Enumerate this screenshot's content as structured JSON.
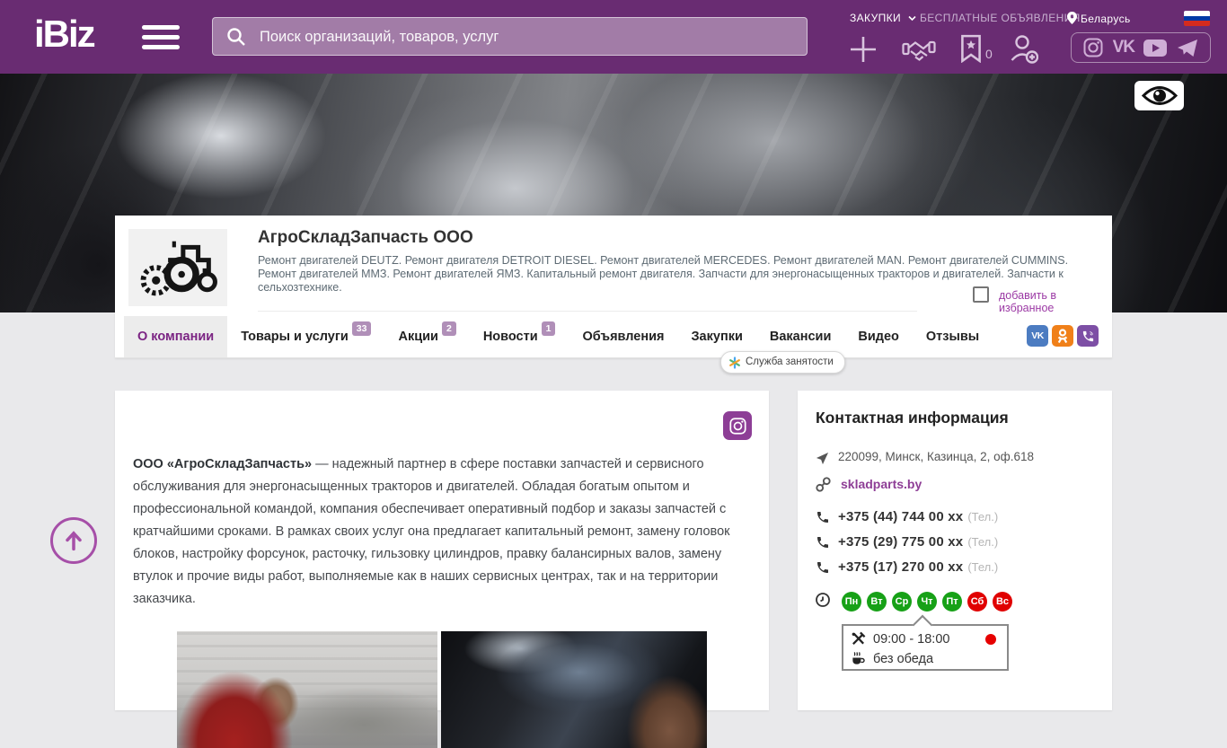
{
  "header": {
    "logo": "iBiz",
    "search_placeholder": "Поиск организаций, товаров, услуг",
    "links": {
      "purchases": "ЗАКУПКИ",
      "free_ads": "БЕСПЛАТНЫЕ ОБЪЯВЛЕНИЯ",
      "country": "Беларусь"
    },
    "favorites_count": "0",
    "icons": {
      "search": "magnifier",
      "menu": "hamburger",
      "location": "map-pin",
      "add": "plus",
      "partners": "handshake",
      "favorites": "bookmark-star",
      "profile": "user-add",
      "flag": "russia-tricolor",
      "vk_label": "VK",
      "socials": [
        "instagram",
        "vk",
        "youtube",
        "telegram"
      ]
    }
  },
  "company": {
    "name": "АгроСкладЗапчасть ООО",
    "summary": "Ремонт двигателей DEUTZ. Ремонт двигателя DETROIT DIESEL. Ремонт двигателей MERCEDES. Ремонт двигателей MAN. Ремонт двигателей CUMMINS. Ремонт двигателей ММЗ. Ремонт двигателей ЯМЗ. Капитальный ремонт двигателя. Запчасти для энергонасыщенных тракторов и двигателей. Запчасти к сельхозтехнике.",
    "add_favorite": "добавить в избранное",
    "logo_icon": "tractor-gear"
  },
  "tabs": [
    {
      "label": "О компании",
      "active": true
    },
    {
      "label": "Товары и услуги",
      "badge": "33"
    },
    {
      "label": "Акции",
      "badge": "2"
    },
    {
      "label": "Новости",
      "badge": "1"
    },
    {
      "label": "Объявления"
    },
    {
      "label": "Закупки"
    },
    {
      "label": "Вакансии"
    },
    {
      "label": "Видео"
    },
    {
      "label": "Отзывы"
    }
  ],
  "tab_socials": {
    "vk": "VK",
    "ok": "odnoklassniki",
    "viber": "viber"
  },
  "tooltip": {
    "label": "Служба занятости"
  },
  "about": {
    "lead_bold": "ООО «АгроСкладЗапчасть»",
    "text": " — надежный партнер в сфере поставки запчастей и сервисного обслуживания для энергонасыщенных тракторов и двигателей. Обладая богатым опытом и профессиональной командой, компания обеспечивает оперативный подбор и заказы запчастей с кратчайшими сроками. В рамках своих услуг она предлагает капитальный ремонт, замену головок блоков, настройку форсунок, расточку, гильзовку цилиндров, правку балансирных валов, замену втулок и прочие виды работ, выполняемые как в наших сервисных центрах, так и на территории заказчика."
  },
  "contact": {
    "title": "Контактная информация",
    "address": "220099, Минск, Казинца, 2, оф.618",
    "website": "skladparts.by",
    "phones": [
      {
        "number": "+375 (44) 744 00 xx",
        "type": "(Тел.)"
      },
      {
        "number": "+375 (29) 775 00 xx",
        "type": "(Тел.)"
      },
      {
        "number": "+375 (17) 270 00 xx",
        "type": "(Тел.)"
      }
    ],
    "days": [
      {
        "label": "Пн",
        "status": "open"
      },
      {
        "label": "Вт",
        "status": "open"
      },
      {
        "label": "Ср",
        "status": "open"
      },
      {
        "label": "Чт",
        "status": "open"
      },
      {
        "label": "Пт",
        "status": "open"
      },
      {
        "label": "Сб",
        "status": "closed"
      },
      {
        "label": "Вс",
        "status": "closed"
      }
    ],
    "schedule": {
      "hours": "09:00 - 18:00",
      "lunch": "без обеда"
    }
  },
  "colors": {
    "header_purple": "#692c72",
    "accent_purple": "#8e3e96",
    "active_tab": "#7b2483",
    "badge": "#b08fb8",
    "day_open": "#17a117",
    "day_closed": "#e00000",
    "vk": "#4c7cc1",
    "ok": "#f08019",
    "viber": "#7d4fa5",
    "status_dot": "#e60000"
  }
}
